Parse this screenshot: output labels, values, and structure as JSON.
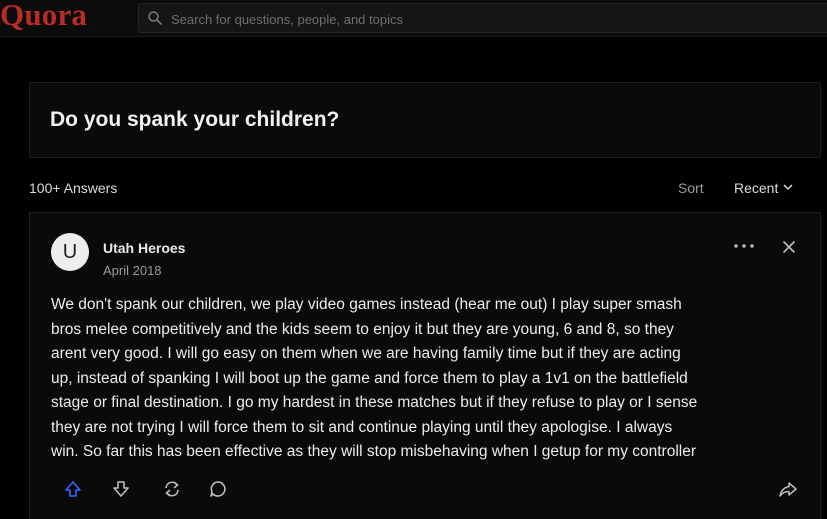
{
  "app": {
    "logo_text": "Quora",
    "brand_color": "#b92b27"
  },
  "search": {
    "placeholder": "Search for questions, people, and topics",
    "value": ""
  },
  "question": {
    "title": "Do you spank your children?"
  },
  "answers_bar": {
    "count_label": "100+ Answers",
    "sort_label": "Sort",
    "sort_value": "Recent"
  },
  "answer": {
    "avatar_letter": "U",
    "author_name": "Utah Heroes",
    "date": "April 2018",
    "lines": [
      "We don't spank our children, we play video games instead (hear me out) I play super smash",
      "bros melee competitively and the kids seem to enjoy it but they are young, 6 and 8, so they",
      "arent very good. I will go easy on them when we are having family time but if they are acting",
      "up, instead of spanking I will boot up the game and force them to play a 1v1 on the battlefield",
      "stage or final destination. I go my hardest in these matches but if they refuse to play or I sense",
      "they are not trying I will force them to sit and continue playing until they apologise. I always",
      "win. So far this has been effective as they will stop misbehaving when I getup for my controller"
    ]
  },
  "icons": {
    "search": "search-icon",
    "sort": "chevron-down-icon",
    "more": "more-horizontal-icon",
    "close": "close-icon",
    "upvote": "upvote-arrow-icon",
    "downvote": "downvote-arrow-icon",
    "share": "reshare-icon",
    "comment": "comment-icon",
    "forward": "share-forward-icon"
  },
  "colors": {
    "background": "#000000",
    "upvote_accent": "#2e69ff"
  }
}
